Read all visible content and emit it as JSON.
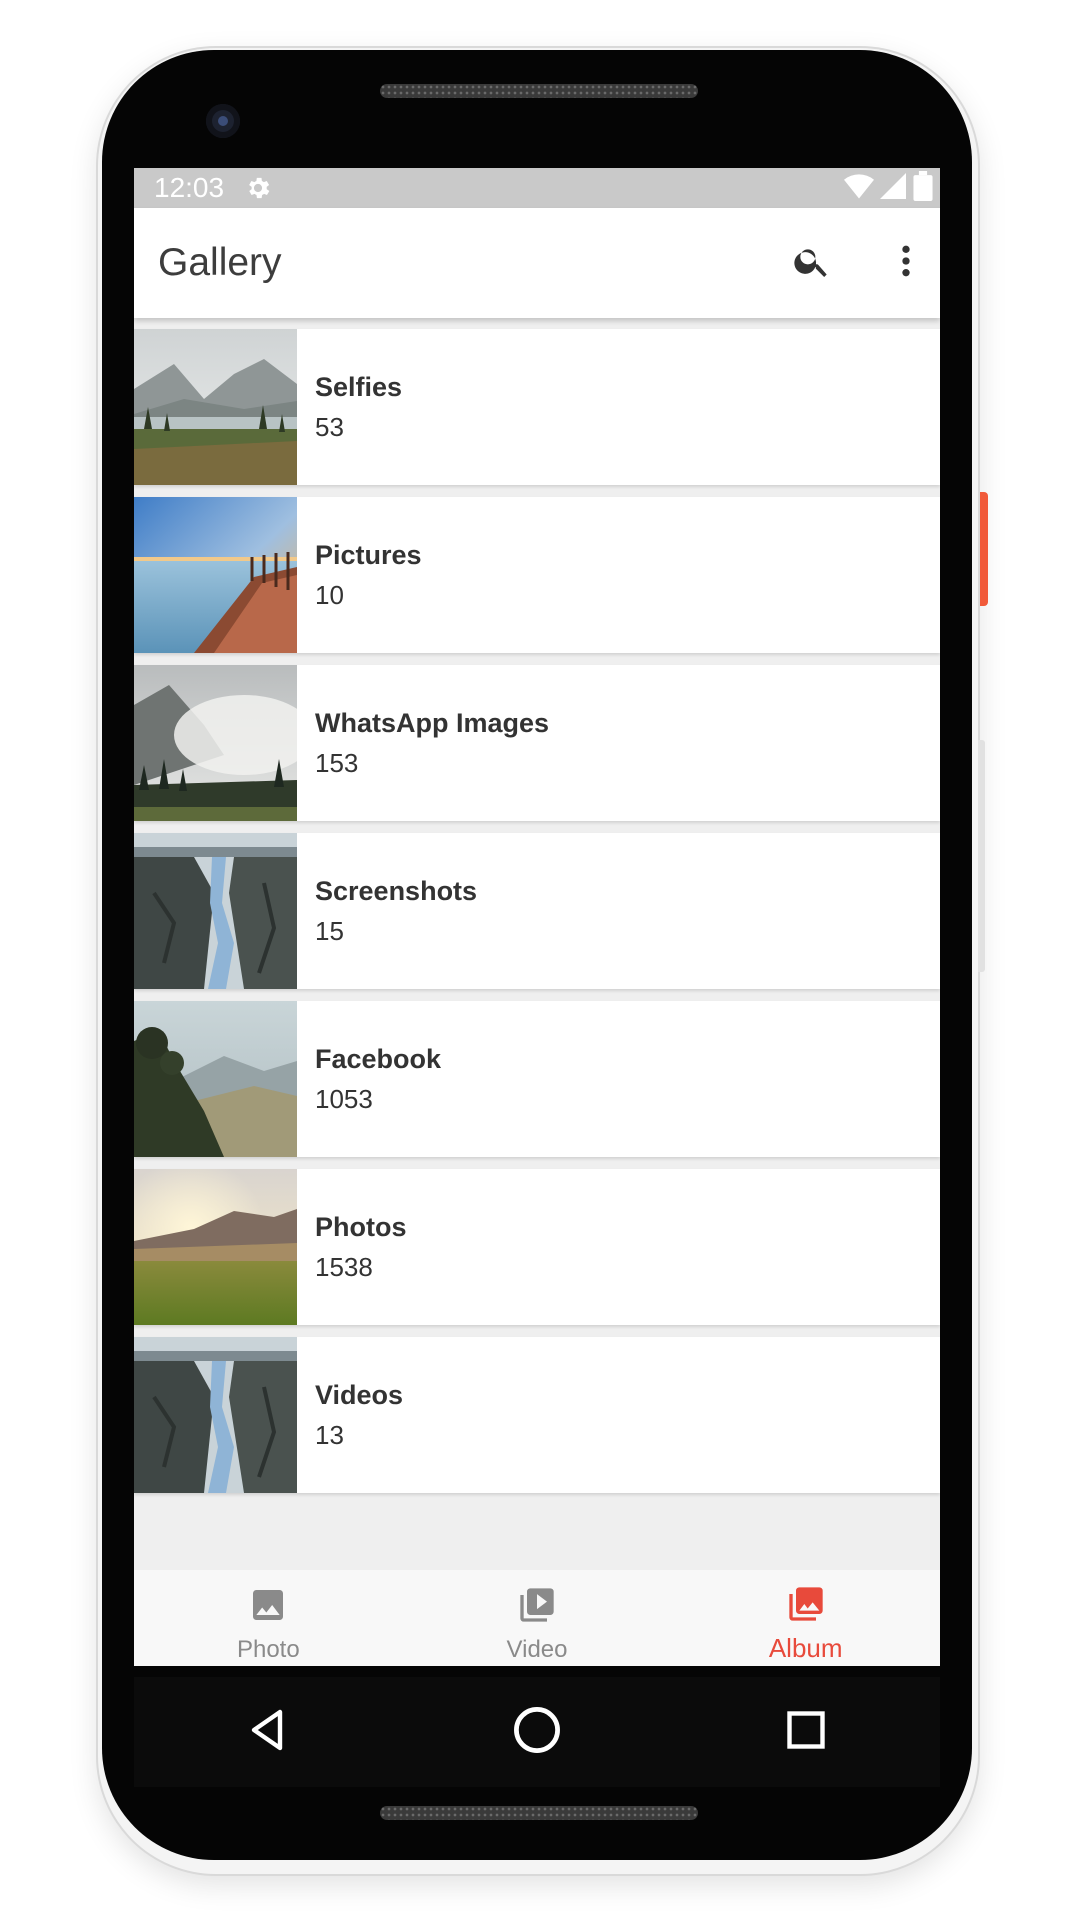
{
  "status_bar": {
    "time": "12:03",
    "icons": [
      "settings-icon",
      "wifi-icon",
      "signal-icon",
      "battery-icon"
    ]
  },
  "app_bar": {
    "title": "Gallery",
    "actions": [
      "search-icon",
      "more-vert-icon"
    ]
  },
  "albums": [
    {
      "name": "Selfies",
      "count": "53",
      "thumb": "lake-mountains"
    },
    {
      "name": "Pictures",
      "count": "10",
      "thumb": "pier-sunset"
    },
    {
      "name": "WhatsApp Images",
      "count": "153",
      "thumb": "misty-forest"
    },
    {
      "name": "Screenshots",
      "count": "15",
      "thumb": "river-canyon"
    },
    {
      "name": "Facebook",
      "count": "1053",
      "thumb": "hazy-hills"
    },
    {
      "name": "Photos",
      "count": "1538",
      "thumb": "sunset-meadow"
    },
    {
      "name": "Videos",
      "count": "13",
      "thumb": "river-canyon"
    }
  ],
  "bottom_nav": {
    "items": [
      {
        "label": "Photo",
        "icon": "image-icon",
        "active": false
      },
      {
        "label": "Video",
        "icon": "video-library-icon",
        "active": false
      },
      {
        "label": "Album",
        "icon": "photo-library-icon",
        "active": true
      }
    ]
  },
  "system_nav": [
    "back-icon",
    "home-icon",
    "recents-icon"
  ],
  "colors": {
    "accent": "#e84a3b",
    "nav_inactive": "#8a8a8a",
    "status_bar": "#c9c9c9",
    "list_background": "#efefef"
  }
}
